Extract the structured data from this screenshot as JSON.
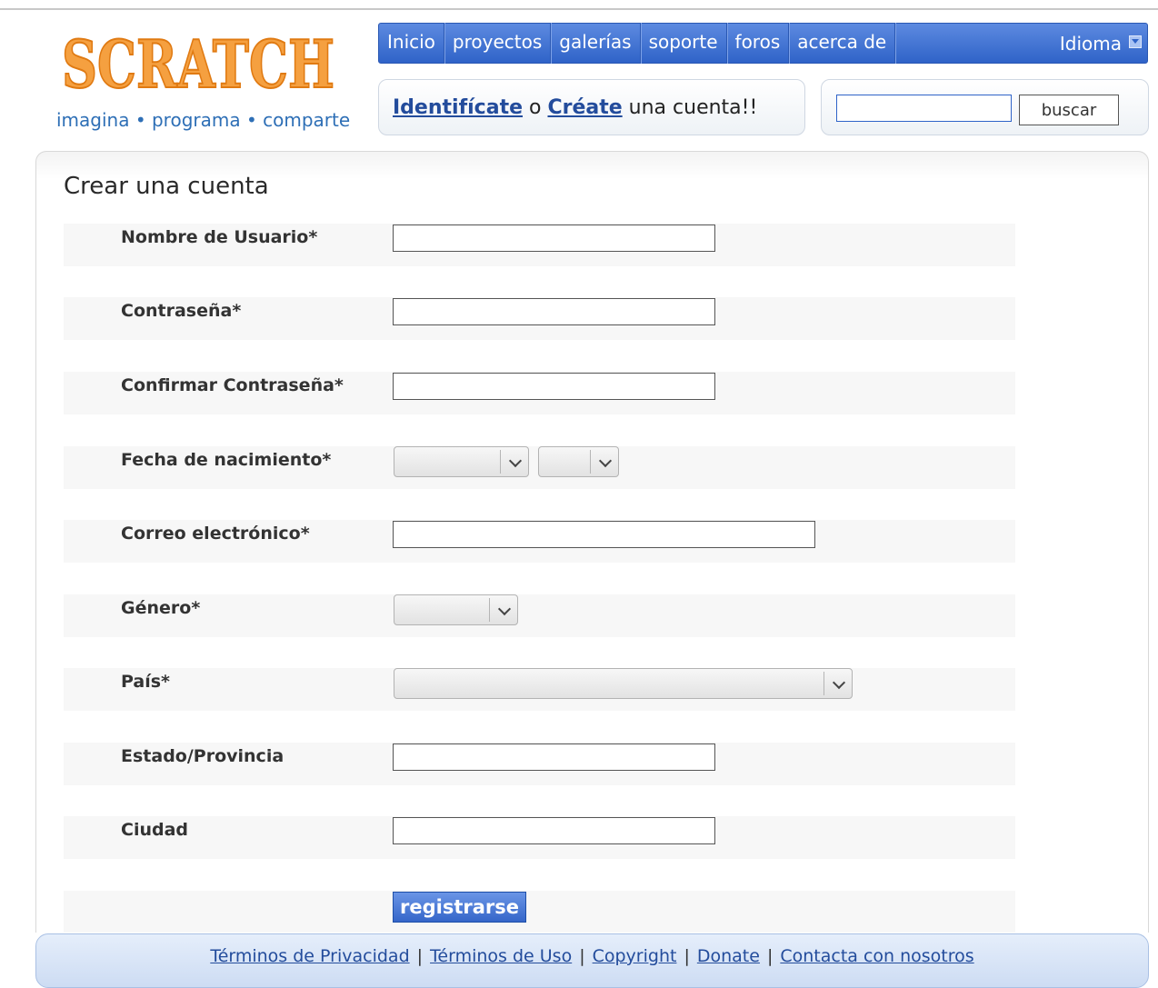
{
  "logo": {
    "text": "SCRATCH",
    "tagline": "imagina • programa • comparte"
  },
  "nav": {
    "items": [
      "Inicio",
      "proyectos",
      "galerías",
      "soporte",
      "foros",
      "acerca de"
    ],
    "language": "Idioma"
  },
  "login": {
    "signin_link": "Identifícate",
    "connector": " o ",
    "create_link": "Créate",
    "suffix": " una cuenta!!"
  },
  "search": {
    "button_label": "buscar",
    "value": ""
  },
  "page_title": "Crear una cuenta",
  "form": {
    "username_label": "Nombre de Usuario*",
    "password_label": "Contraseña*",
    "confirm_password_label": "Confirmar Contraseña*",
    "birthdate_label": "Fecha de nacimiento*",
    "email_label": "Correo electrónico*",
    "gender_label": "Género*",
    "country_label": "País*",
    "state_label": "Estado/Provincia",
    "city_label": "Ciudad",
    "submit_label": "registrarse"
  },
  "footer": {
    "links": [
      "Términos de Privacidad",
      "Términos de Uso",
      "Copyright",
      "Donate",
      "Contacta con nosotros"
    ],
    "separator": "|"
  },
  "colors": {
    "nav_blue": "#2f63c8",
    "link_blue": "#234c9c",
    "logo_orange": "#f5a040"
  }
}
